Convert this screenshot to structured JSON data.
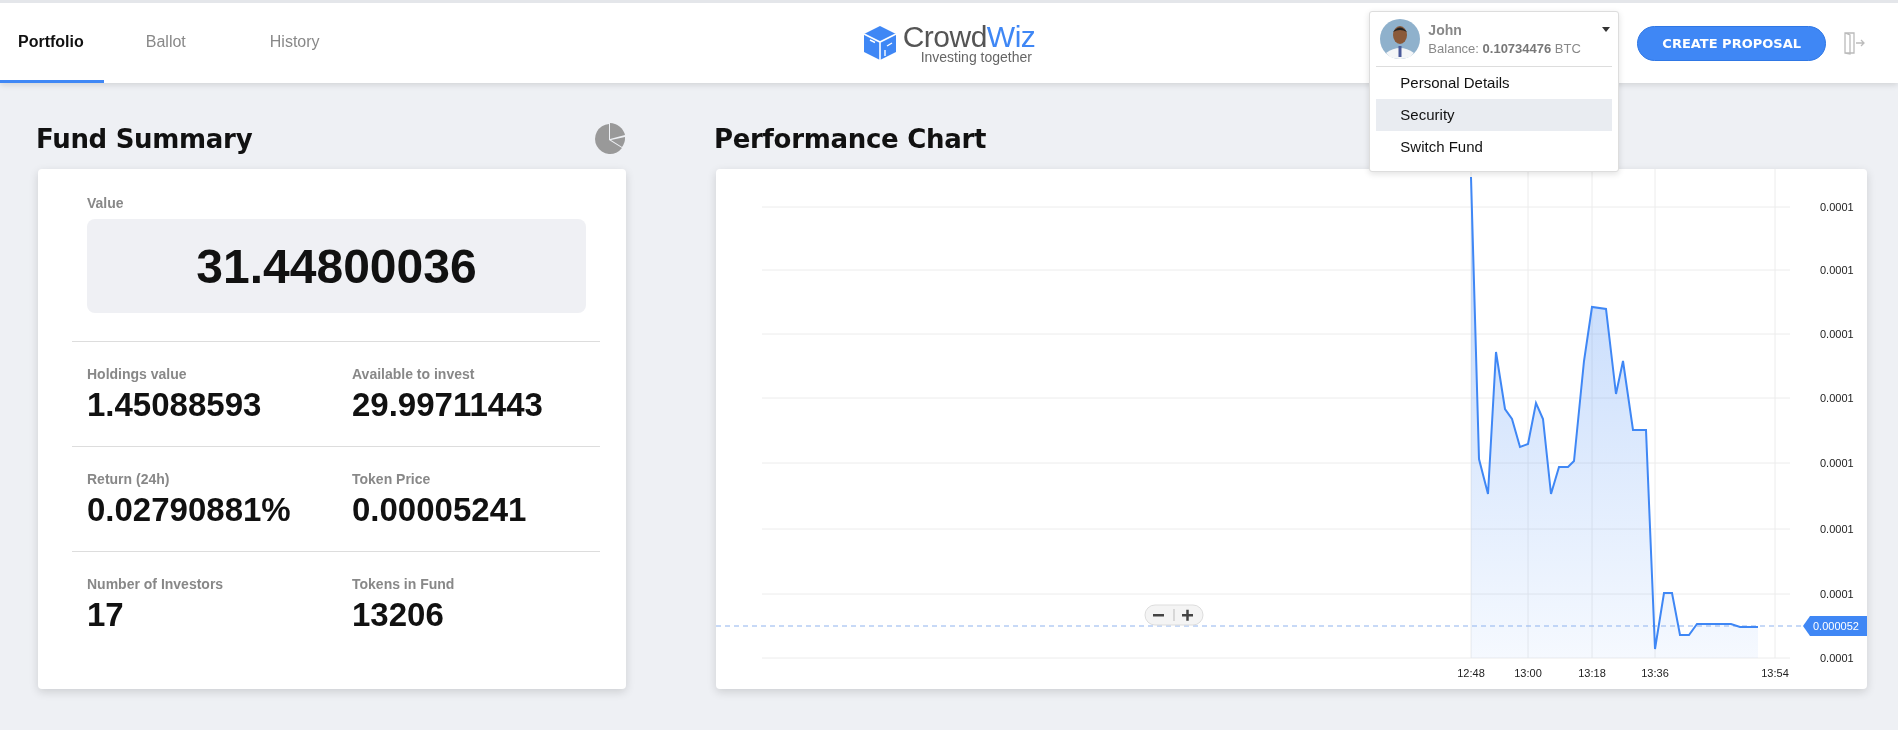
{
  "tabs": [
    {
      "label": "Portfolio",
      "selected": true
    },
    {
      "label": "Ballot",
      "selected": false
    },
    {
      "label": "History",
      "selected": false
    }
  ],
  "logo": {
    "wordmark": [
      "Crowd",
      "Wiz"
    ],
    "tagline": "Investing together"
  },
  "user": {
    "name": "John",
    "balance": "Balance: **0.10734476** BTC",
    "menu": [
      {
        "label": "Personal Details",
        "selected": false
      },
      {
        "label": "Security",
        "selected": true
      },
      {
        "label": "Switch Fund",
        "selected": false
      }
    ]
  },
  "create_button": "CREATE PROPOSAL",
  "fund_summary": {
    "title": "Fund Summary",
    "value_label": "Value",
    "value": "31.44800036",
    "stats": [
      {
        "label": "Holdings value",
        "value": "1.45088593"
      },
      {
        "label": "Available to invest",
        "value": "29.99711443"
      },
      {
        "label": "Return (24h)",
        "value": "0.02790881%"
      },
      {
        "label": "Token Price",
        "value": "0.00005241"
      },
      {
        "label": "Number of Investors",
        "value": "17"
      },
      {
        "label": "Tokens in Fund",
        "value": "13206"
      }
    ]
  },
  "performance_chart": {
    "title": "Performance Chart",
    "y_labels": [
      "0.0001",
      "0.0001",
      "0.0001",
      "0.0001",
      "0.0001",
      "0.0001",
      "0.0001",
      "0.0001"
    ],
    "x_labels": [
      "12:48",
      "13:00",
      "13:18",
      "13:36",
      "13:54"
    ],
    "current_price": "0.000052"
  }
}
